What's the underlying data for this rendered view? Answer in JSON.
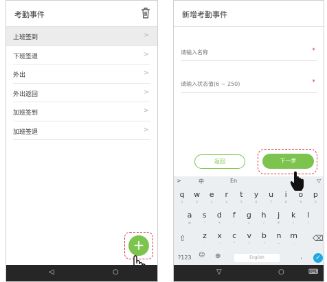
{
  "left_screen": {
    "title": "考勤事件",
    "icons": {
      "delete": "trash-icon",
      "add": "plus-icon",
      "chevron": "chevron-right-icon"
    },
    "items": [
      {
        "label": "上班签到",
        "selected": true
      },
      {
        "label": "下班签退",
        "selected": false
      },
      {
        "label": "外出",
        "selected": false
      },
      {
        "label": "外出返回",
        "selected": false
      },
      {
        "label": "加班签到",
        "selected": false
      },
      {
        "label": "加班签退",
        "selected": false
      }
    ],
    "fab_glyph": "+",
    "nav": {
      "back": "◁",
      "home": "○"
    }
  },
  "right_screen": {
    "title": "新增考勤事件",
    "name_placeholder": "请输入名称",
    "status_placeholder": "请输入状态值(6 ~ 250)",
    "required_mark": "*",
    "back_button": "返回",
    "next_button": "下一步",
    "keyboard": {
      "toolbar": {
        "arrow": ">",
        "chinese": "中",
        "english": "En",
        "dropdown": "▽"
      },
      "row1": [
        {
          "k": "q",
          "s": "1"
        },
        {
          "k": "w",
          "s": "2"
        },
        {
          "k": "e",
          "s": "3"
        },
        {
          "k": "r",
          "s": "4"
        },
        {
          "k": "t",
          "s": "5"
        },
        {
          "k": "y",
          "s": "6"
        },
        {
          "k": "u",
          "s": "7"
        },
        {
          "k": "i",
          "s": "8"
        },
        {
          "k": "o",
          "s": "9"
        },
        {
          "k": "p",
          "s": "0"
        }
      ],
      "row2": [
        {
          "k": "a",
          "s": "@"
        },
        {
          "k": "s",
          "s": "*"
        },
        {
          "k": "d",
          "s": "+"
        },
        {
          "k": "f",
          "s": "-"
        },
        {
          "k": "g",
          "s": "="
        },
        {
          "k": "h",
          "s": "/"
        },
        {
          "k": "j",
          "s": "#"
        },
        {
          "k": "k",
          "s": "("
        },
        {
          "k": "l",
          "s": ")"
        }
      ],
      "row3": [
        {
          "k": "z",
          "s": "'"
        },
        {
          "k": "x",
          "s": ":"
        },
        {
          "k": "c",
          "s": "\""
        },
        {
          "k": "v",
          "s": "?"
        },
        {
          "k": "b",
          "s": "!"
        },
        {
          "k": "n",
          "s": "~"
        },
        {
          "k": "m",
          "s": "…"
        }
      ],
      "shift": "⇧",
      "backspace": "⌫",
      "symbols": "?123",
      "emoji": "☺",
      "globe": "⊕",
      "space": "English",
      "period": ".",
      "enter": "✓"
    },
    "nav": {
      "back": "▽",
      "home": "○",
      "keyboard": "⌨"
    }
  },
  "colors": {
    "accent_green": "#7cc44d",
    "highlight_red": "#d43030",
    "navbar": "#262626"
  }
}
